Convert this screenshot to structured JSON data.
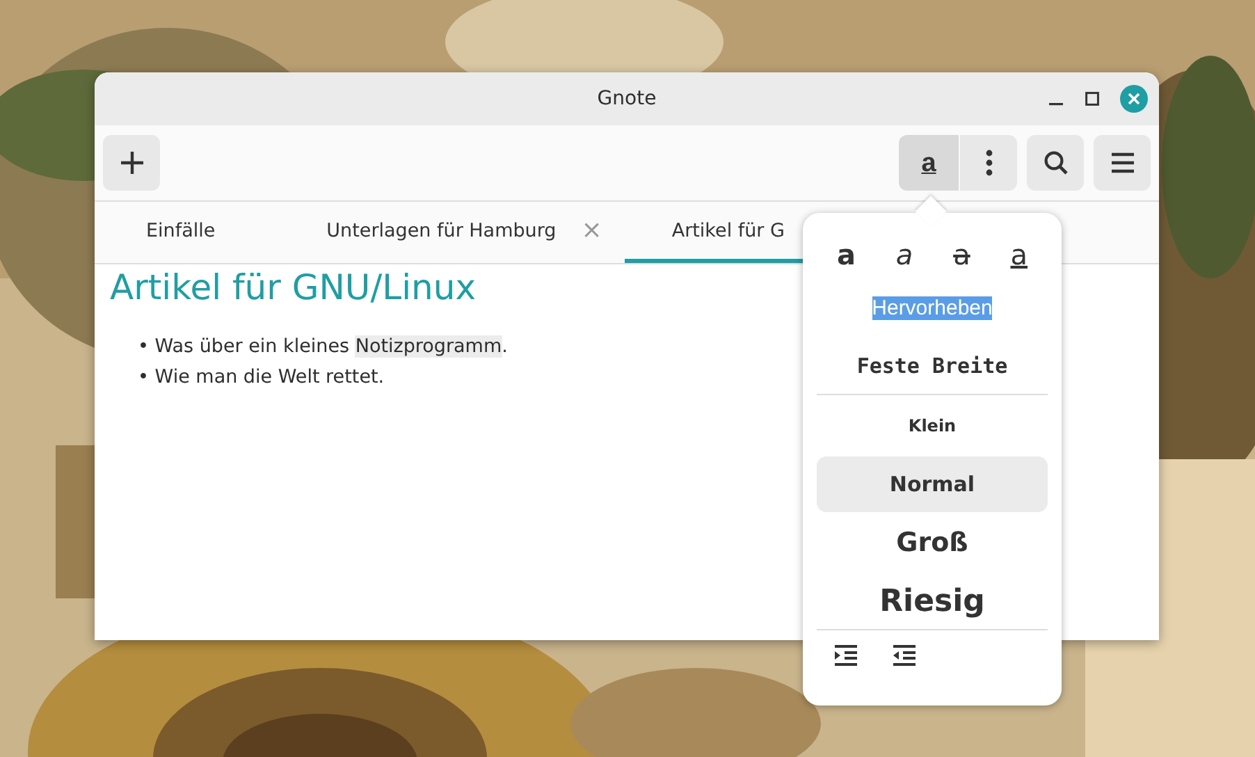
{
  "window": {
    "title": "Gnote"
  },
  "toolbar": {
    "format_button": {
      "glyph": "a",
      "active": true
    }
  },
  "tabs": [
    {
      "label": "Einfälle",
      "selected": false
    },
    {
      "label": "Unterlagen für Hamburg",
      "selected": false,
      "close": "×"
    },
    {
      "label": "Artikel für G",
      "selected": true
    }
  ],
  "note": {
    "title": "Artikel für GNU/Linux",
    "bullets": [
      {
        "marker": "•",
        "segments": [
          {
            "text": "Was über ein kleines ",
            "highlighted": false
          },
          {
            "text": "Notizprogramm",
            "highlighted": true
          },
          {
            "text": ".",
            "highlighted": false
          }
        ]
      },
      {
        "marker": "•",
        "segments": [
          {
            "text": "Wie man die Welt rettet.",
            "highlighted": false
          }
        ]
      }
    ]
  },
  "format_popover": {
    "styles": [
      {
        "kind": "bold",
        "glyph": "a"
      },
      {
        "kind": "italic",
        "glyph": "a"
      },
      {
        "kind": "strike",
        "glyph": "a"
      },
      {
        "kind": "underline",
        "glyph": "a"
      }
    ],
    "options": [
      {
        "kind": "highlight",
        "label": "Hervorheben"
      },
      {
        "kind": "monospace",
        "label": "Feste Breite"
      }
    ],
    "sizes": [
      {
        "kind": "small",
        "label": "Klein",
        "selected": false
      },
      {
        "kind": "normal",
        "label": "Normal",
        "selected": true
      },
      {
        "kind": "large",
        "label": "Groß",
        "selected": false
      },
      {
        "kind": "huge",
        "label": "Riesig",
        "selected": false
      }
    ]
  }
}
